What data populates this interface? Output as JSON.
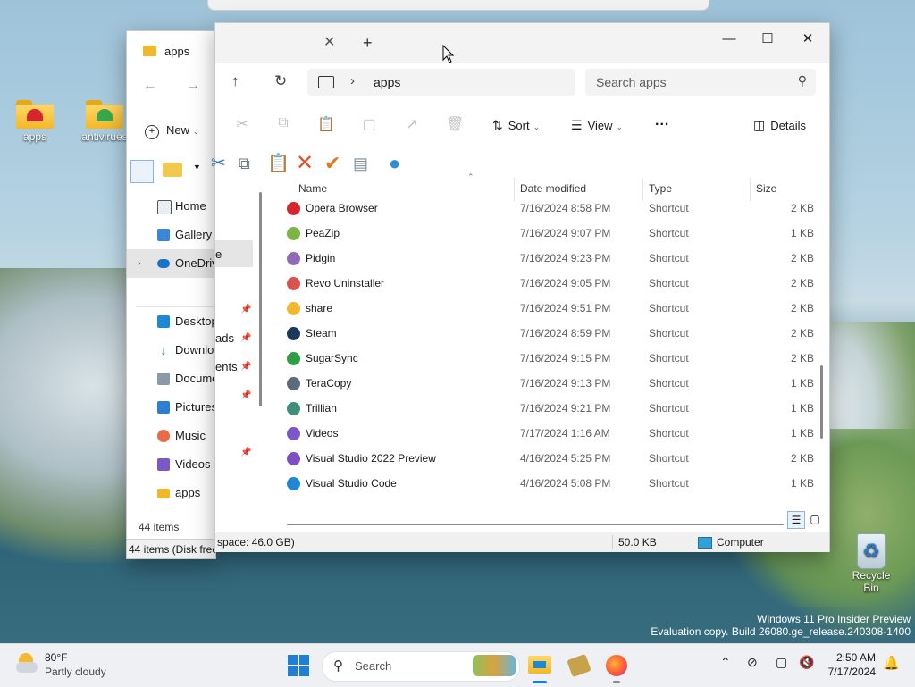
{
  "desktop": {
    "icons": [
      {
        "label": "apps"
      },
      {
        "label": "antivirues"
      }
    ],
    "recycle_bin": "Recycle Bin",
    "watermark": {
      "line1": "Windows 11 Pro Insider Preview",
      "line2": "Evaluation copy. Build 26080.ge_release.240308-1400"
    }
  },
  "back_window": {
    "tab_title": "apps",
    "new_label": "New",
    "nav_items": [
      {
        "label": "Home",
        "icon": "home-icon"
      },
      {
        "label": "Gallery",
        "icon": "gallery-icon"
      },
      {
        "label": "OneDriv",
        "icon": "cloud-icon"
      },
      {
        "label": "Desktop",
        "icon": "desktop-icon"
      },
      {
        "label": "Downlo",
        "icon": "download-icon"
      },
      {
        "label": "Docume",
        "icon": "document-icon"
      },
      {
        "label": "Pictures",
        "icon": "pictures-icon"
      },
      {
        "label": "Music",
        "icon": "music-icon"
      },
      {
        "label": "Videos",
        "icon": "videos-icon"
      },
      {
        "label": "apps",
        "icon": "folder-icon"
      }
    ],
    "item_count": "44 items",
    "status": "44 items (Disk free"
  },
  "main_window": {
    "address": {
      "crumb": "apps"
    },
    "search": {
      "placeholder": "Search apps"
    },
    "commands": {
      "sort": "Sort",
      "view": "View",
      "more": "...",
      "details": "Details"
    },
    "nav_fragments": {
      "onedrive": "e",
      "downloads": "ads",
      "documents": "ents"
    },
    "columns": {
      "name": "Name",
      "date": "Date modified",
      "type": "Type",
      "size": "Size"
    },
    "files": [
      {
        "name": "Opera Browser",
        "date": "7/16/2024 8:58 PM",
        "type": "Shortcut",
        "size": "2 KB",
        "color": "#d6262d"
      },
      {
        "name": "PeaZip",
        "date": "7/16/2024 9:07 PM",
        "type": "Shortcut",
        "size": "1 KB",
        "color": "#7cb342"
      },
      {
        "name": "Pidgin",
        "date": "7/16/2024 9:23 PM",
        "type": "Shortcut",
        "size": "2 KB",
        "color": "#8e6bb8"
      },
      {
        "name": "Revo Uninstaller",
        "date": "7/16/2024 9:05 PM",
        "type": "Shortcut",
        "size": "2 KB",
        "color": "#d9534f"
      },
      {
        "name": "share",
        "date": "7/16/2024 9:51 PM",
        "type": "Shortcut",
        "size": "2 KB",
        "color": "#f2b82b"
      },
      {
        "name": "Steam",
        "date": "7/16/2024 8:59 PM",
        "type": "Shortcut",
        "size": "2 KB",
        "color": "#1b3a5b"
      },
      {
        "name": "SugarSync",
        "date": "7/16/2024 9:15 PM",
        "type": "Shortcut",
        "size": "2 KB",
        "color": "#2e9e44"
      },
      {
        "name": "TeraCopy",
        "date": "7/16/2024 9:13 PM",
        "type": "Shortcut",
        "size": "1 KB",
        "color": "#5a6b7a"
      },
      {
        "name": "Trillian",
        "date": "7/16/2024 9:21 PM",
        "type": "Shortcut",
        "size": "1 KB",
        "color": "#3f8f7a"
      },
      {
        "name": "Videos",
        "date": "7/17/2024 1:16 AM",
        "type": "Shortcut",
        "size": "1 KB",
        "color": "#7b57c9"
      },
      {
        "name": "Visual Studio 2022 Preview",
        "date": "4/16/2024 5:25 PM",
        "type": "Shortcut",
        "size": "2 KB",
        "color": "#7f4fc2"
      },
      {
        "name": "Visual Studio Code",
        "date": "4/16/2024 5:08 PM",
        "type": "Shortcut",
        "size": "1 KB",
        "color": "#1e88d6"
      }
    ],
    "status": {
      "disk_free": "space: 46.0 GB)",
      "size": "50.0 KB",
      "location": "Computer"
    }
  },
  "taskbar": {
    "weather": {
      "temp": "80°F",
      "condition": "Partly cloudy"
    },
    "search_placeholder": "Search",
    "clock": {
      "time": "2:50 AM",
      "date": "7/17/2024"
    }
  }
}
